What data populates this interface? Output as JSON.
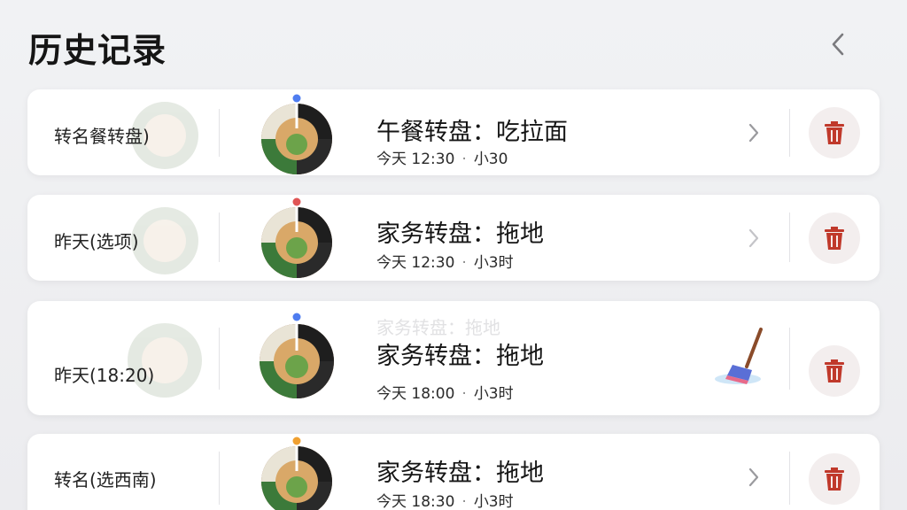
{
  "header": {
    "title": "历史记录",
    "back_icon": "chevron-left-icon"
  },
  "colors": {
    "background": "#efeff2",
    "card": "#ffffff",
    "delete_button_bg": "#f3eeee",
    "trash_red": "#c0392b"
  },
  "records": [
    {
      "label": "转名餐转盘)",
      "wheel_title": "午餐转盘：吃拉面",
      "time": "今天 12:30",
      "extra": "小30"
    },
    {
      "label": "昨天(选项)",
      "wheel_title": "家务转盘：拖地",
      "time": "今天 12:30",
      "extra": "小3时"
    },
    {
      "label": "昨天(18:20)",
      "wheel_title": "家务转盘：拖地",
      "time": "今天 18:00",
      "extra": "小3时",
      "ghost_title": "家务转盘：拖地"
    },
    {
      "label": "转名(选西南)",
      "wheel_title": "家务转盘：拖地",
      "time": "今天 18:30",
      "extra": "小3时"
    }
  ],
  "icons": {
    "chevron": "chevron-right-icon",
    "delete": "trash-icon",
    "wheel": "spin-wheel-icon",
    "mop": "mop-icon"
  }
}
